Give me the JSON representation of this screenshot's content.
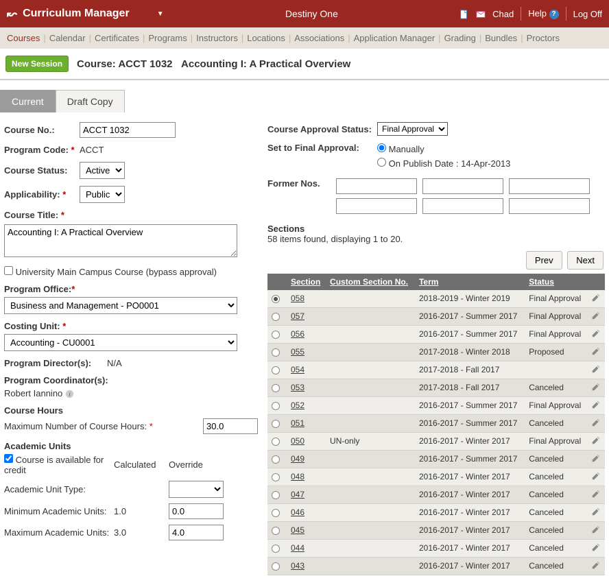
{
  "header": {
    "app_title": "Curriculum Manager",
    "brand": "Destiny One",
    "user": "Chad",
    "help": "Help",
    "logoff": "Log Off"
  },
  "nav": [
    "Courses",
    "Calendar",
    "Certificates",
    "Programs",
    "Instructors",
    "Locations",
    "Associations",
    "Application Manager",
    "Grading",
    "Bundles",
    "Proctors"
  ],
  "page": {
    "new_session": "New Session",
    "course_label": "Course: ACCT 1032",
    "course_name": "Accounting I: A Practical Overview"
  },
  "tabs": {
    "current": "Current",
    "draft": "Draft Copy"
  },
  "left": {
    "course_no_label": "Course No.:",
    "course_no": "ACCT 1032",
    "program_code_label": "Program Code:",
    "program_code": "ACCT",
    "course_status_label": "Course Status:",
    "course_status": "Active",
    "applicability_label": "Applicability:",
    "applicability": "Public",
    "course_title_label": "Course Title:",
    "course_title": "Accounting I: A Practical Overview",
    "bypass_label": "University Main Campus Course (bypass approval)",
    "program_office_label": "Program Office:",
    "program_office": "Business and Management - PO0001",
    "costing_unit_label": "Costing Unit:",
    "costing_unit": "Accounting - CU0001",
    "program_directors_label": "Program Director(s):",
    "program_directors": "N/A",
    "program_coord_label": "Program Coordinator(s):",
    "program_coord": "Robert Iannino",
    "course_hours_hdr": "Course Hours",
    "max_hours_label": "Maximum Number of Course Hours:",
    "max_hours": "30.0",
    "au_hdr": "Academic Units",
    "credit_label": "Course is available for credit",
    "calculated": "Calculated",
    "override": "Override",
    "au_type_label": "Academic Unit Type:",
    "min_au_label": "Minimum Academic Units:",
    "min_au_calc": "1.0",
    "min_au_over": "0.0",
    "max_au_label": "Maximum Academic Units:",
    "max_au_calc": "3.0",
    "max_au_over": "4.0"
  },
  "right": {
    "approval_status_label": "Course Approval Status:",
    "approval_status": "Final Approval",
    "set_final_label": "Set to Final Approval:",
    "manually": "Manually",
    "on_publish": "On Publish Date : 14-Apr-2013",
    "former_nos_label": "Former Nos.",
    "sections_hdr": "Sections",
    "sections_sub": "58 items found, displaying 1 to 20.",
    "prev": "Prev",
    "next": "Next",
    "cols": {
      "section": "Section",
      "custom": "Custom Section No.",
      "term": "Term",
      "status": "Status"
    }
  },
  "sections": [
    {
      "sel": true,
      "sec": "058",
      "custom": "",
      "term": "2018-2019 - Winter 2019",
      "status": "Final Approval"
    },
    {
      "sel": false,
      "sec": "057",
      "custom": "",
      "term": "2016-2017 - Summer 2017",
      "status": "Final Approval"
    },
    {
      "sel": false,
      "sec": "056",
      "custom": "",
      "term": "2016-2017 - Summer 2017",
      "status": "Final Approval"
    },
    {
      "sel": false,
      "sec": "055",
      "custom": "",
      "term": "2017-2018 - Winter 2018",
      "status": "Proposed"
    },
    {
      "sel": false,
      "sec": "054",
      "custom": "",
      "term": "2017-2018 - Fall 2017",
      "status": ""
    },
    {
      "sel": false,
      "sec": "053",
      "custom": "",
      "term": "2017-2018 - Fall 2017",
      "status": "Canceled"
    },
    {
      "sel": false,
      "sec": "052",
      "custom": "",
      "term": "2016-2017 - Summer 2017",
      "status": "Final Approval"
    },
    {
      "sel": false,
      "sec": "051",
      "custom": "",
      "term": "2016-2017 - Summer 2017",
      "status": "Canceled"
    },
    {
      "sel": false,
      "sec": "050",
      "custom": "UN-only",
      "term": "2016-2017 - Winter 2017",
      "status": "Final Approval"
    },
    {
      "sel": false,
      "sec": "049",
      "custom": "",
      "term": "2016-2017 - Summer 2017",
      "status": "Canceled"
    },
    {
      "sel": false,
      "sec": "048",
      "custom": "",
      "term": "2016-2017 - Winter 2017",
      "status": "Canceled"
    },
    {
      "sel": false,
      "sec": "047",
      "custom": "",
      "term": "2016-2017 - Winter 2017",
      "status": "Canceled"
    },
    {
      "sel": false,
      "sec": "046",
      "custom": "",
      "term": "2016-2017 - Winter 2017",
      "status": "Canceled"
    },
    {
      "sel": false,
      "sec": "045",
      "custom": "",
      "term": "2016-2017 - Winter 2017",
      "status": "Canceled"
    },
    {
      "sel": false,
      "sec": "044",
      "custom": "",
      "term": "2016-2017 - Winter 2017",
      "status": "Canceled"
    },
    {
      "sel": false,
      "sec": "043",
      "custom": "",
      "term": "2016-2017 - Winter 2017",
      "status": "Canceled"
    }
  ]
}
